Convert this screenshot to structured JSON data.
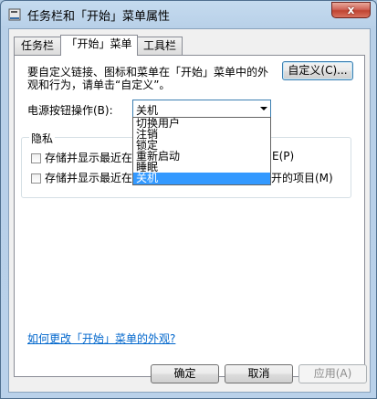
{
  "window": {
    "title": "任务栏和「开始」菜单属性",
    "close_label": "x"
  },
  "tabs": [
    {
      "label": "任务栏"
    },
    {
      "label": "「开始」菜单"
    },
    {
      "label": "工具栏"
    }
  ],
  "start_menu": {
    "description": "要自定义链接、图标和菜单在「开始」菜单中的外观和行为，请单击“自定义”。",
    "customize_button": "自定义(C)...",
    "power_label": "电源按钮操作(B):",
    "power_value": "关机",
    "power_options": [
      "切换用户",
      "注销",
      "锁定",
      "重新启动",
      "睡眠",
      "关机"
    ],
    "privacy_group_title": "隐私",
    "privacy_checks": [
      {
        "label": "存储并显示最近在",
        "suffix": "E(P)",
        "checked": false
      },
      {
        "label": "存储并显示最近在",
        "suffix": "开的项目(M)",
        "checked": false
      }
    ],
    "appearance_link": "如何更改「开始」菜单的外观?"
  },
  "footer": {
    "ok": "确定",
    "cancel": "取消",
    "apply": "应用(A)"
  },
  "colors": {
    "selection": "#3399ff",
    "link": "#0066cc"
  }
}
